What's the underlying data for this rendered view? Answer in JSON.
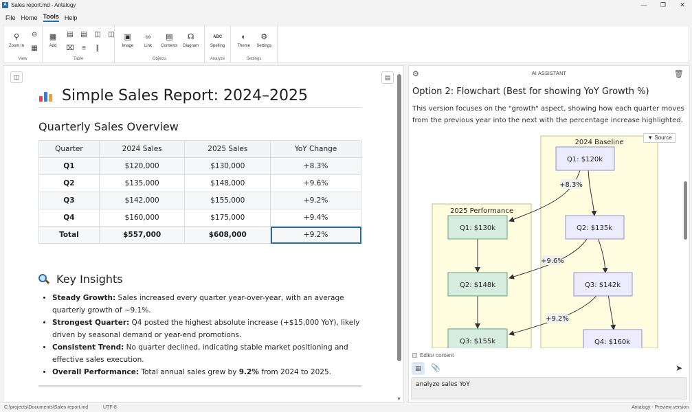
{
  "window": {
    "title": "Sales report.md - Antalogy",
    "app_icon": "A"
  },
  "menu": [
    "File",
    "Home",
    "Tools",
    "Help"
  ],
  "ribbon": {
    "view": {
      "group_label": "View",
      "zoom_in": "Zoom In"
    },
    "table": {
      "group_label": "Table",
      "add": "Add"
    },
    "objects": {
      "group_label": "Objects",
      "image": "Image",
      "link": "Link",
      "contents": "Contents",
      "diagram": "Diagram"
    },
    "analyze": {
      "group_label": "Analyze",
      "spelling": "Spelling"
    },
    "settings": {
      "group_label": "Settings",
      "theme": "Theme",
      "settings": "Settings"
    }
  },
  "document": {
    "title": "Simple Sales Report: 2024–2025",
    "section1": "Quarterly Sales Overview",
    "table": {
      "headers": [
        "Quarter",
        "2024 Sales",
        "2025 Sales",
        "YoY Change"
      ],
      "rows": [
        [
          "Q1",
          "$120,000",
          "$130,000",
          "+8.3%"
        ],
        [
          "Q2",
          "$135,000",
          "$148,000",
          "+9.6%"
        ],
        [
          "Q3",
          "$142,000",
          "$155,000",
          "+9.2%"
        ],
        [
          "Q4",
          "$160,000",
          "$175,000",
          "+9.4%"
        ]
      ],
      "total": [
        "Total",
        "$557,000",
        "$608,000",
        "+9.2%"
      ]
    },
    "section2": "Key Insights",
    "insights": [
      {
        "label": "Steady Growth:",
        "text": " Sales increased every quarter year-over-year, with an average quarterly growth of ~9.1%."
      },
      {
        "label": "Strongest Quarter:",
        "text": " Q4 posted the highest absolute increase (+$15,000 YoY), likely driven by seasonal demand or year-end promotions."
      },
      {
        "label": "Consistent Trend:",
        "text": " No quarter declined, indicating stable market positioning and effective sales execution."
      },
      {
        "label": "Overall Performance:",
        "text_before": " Total annual sales grew by ",
        "highlight": "9.2%",
        "text_after": " from 2024 to 2025."
      }
    ]
  },
  "assistant": {
    "header": "AI ASSISTANT",
    "heading": "Option 2: Flowchart (Best for showing YoY Growth %)",
    "description": "This version focuses on the \"growth\" aspect, showing how each quarter moves from the previous year into the next with the percentage increase highlighted.",
    "source_button": "▼ Source",
    "flowchart": {
      "baseline_label": "2024 Baseline",
      "performance_label": "2025 Performance",
      "baseline_nodes": [
        "Q1: $120k",
        "Q2: $135k",
        "Q3: $142k",
        "Q4: $160k"
      ],
      "performance_nodes": [
        "Q1: $130k",
        "Q2: $148k",
        "Q3: $155k"
      ],
      "edge_labels": [
        "+8.3%",
        "+9.6%",
        "+9.2%"
      ]
    },
    "editor_content_label": "Editor content",
    "prompt_text": "analyze sales YoY"
  },
  "status": {
    "path": "C:\\projects\\Documents\\Sales report.md",
    "encoding": "UTF-8",
    "version": "Antalogy - Preview version"
  },
  "colors": {
    "accent": "#2b6cb0",
    "baseline_bg": "#fffde0",
    "baseline_node": "#ecebff",
    "performance_node": "#d6ecdf"
  }
}
